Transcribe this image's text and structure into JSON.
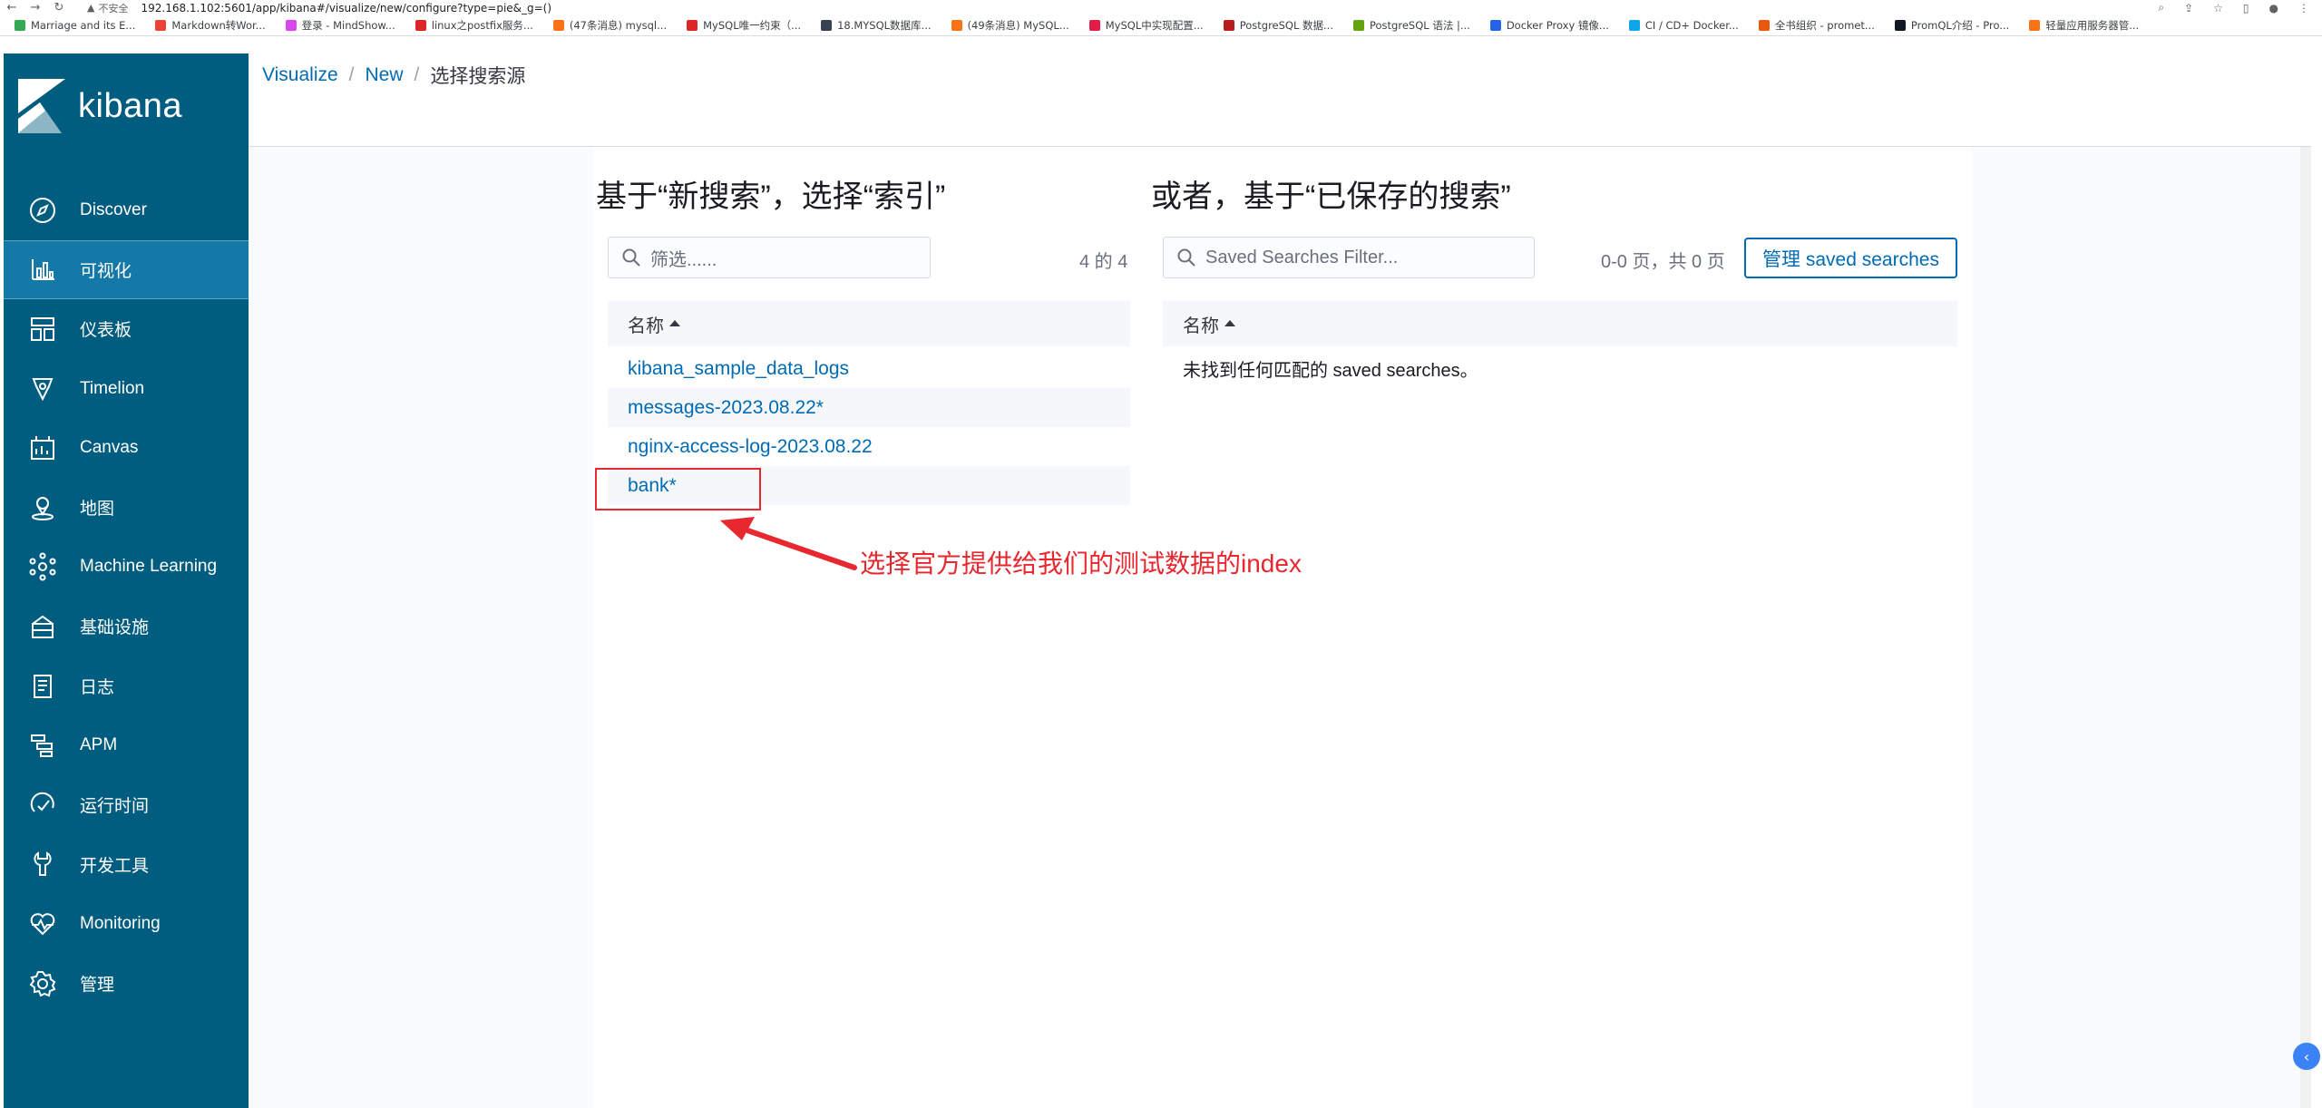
{
  "browser": {
    "warning": "▲",
    "insecure_label": "不安全",
    "url": "192.168.1.102:5601/app/kibana#/visualize/new/configure?type=pie&_g=()",
    "bookmarks": [
      {
        "label": "Marriage and its E...",
        "color": "#34a853"
      },
      {
        "label": "Markdown转Wor...",
        "color": "#ea4335"
      },
      {
        "label": "登录 - MindShow...",
        "color": "#d946ef"
      },
      {
        "label": "linux之postfix服务...",
        "color": "#dc2626"
      },
      {
        "label": "(47条消息) mysql...",
        "color": "#f97316"
      },
      {
        "label": "MySQL唯一约束（...",
        "color": "#dc2626"
      },
      {
        "label": "18.MYSQL数据库...",
        "color": "#374151"
      },
      {
        "label": "(49条消息) MySQL...",
        "color": "#f97316"
      },
      {
        "label": "MySQL中实现配置...",
        "color": "#e11d48"
      },
      {
        "label": "PostgreSQL 数据...",
        "color": "#b91c1c"
      },
      {
        "label": "PostgreSQL 语法 |...",
        "color": "#65a30d"
      },
      {
        "label": "Docker Proxy 镜像...",
        "color": "#2563eb"
      },
      {
        "label": "CI / CD+ Docker...",
        "color": "#0ea5e9"
      },
      {
        "label": "全书组织 - promet...",
        "color": "#ea580c"
      },
      {
        "label": "PromQL介绍 - Pro...",
        "color": "#111827"
      },
      {
        "label": "轻量应用服务器管...",
        "color": "#f97316"
      }
    ]
  },
  "app": {
    "logo_text": "kibana",
    "nav": [
      {
        "label": "Discover",
        "icon": "compass-icon",
        "active": false
      },
      {
        "label": "可视化",
        "icon": "visualize-icon",
        "active": true
      },
      {
        "label": "仪表板",
        "icon": "dashboard-icon",
        "active": false
      },
      {
        "label": "Timelion",
        "icon": "timelion-icon",
        "active": false
      },
      {
        "label": "Canvas",
        "icon": "canvas-icon",
        "active": false
      },
      {
        "label": "地图",
        "icon": "map-icon",
        "active": false
      },
      {
        "label": "Machine Learning",
        "icon": "ml-icon",
        "active": false
      },
      {
        "label": "基础设施",
        "icon": "infrastructure-icon",
        "active": false
      },
      {
        "label": "日志",
        "icon": "logs-icon",
        "active": false
      },
      {
        "label": "APM",
        "icon": "apm-icon",
        "active": false
      },
      {
        "label": "运行时间",
        "icon": "uptime-icon",
        "active": false
      },
      {
        "label": "开发工具",
        "icon": "devtools-icon",
        "active": false
      },
      {
        "label": "Monitoring",
        "icon": "monitoring-icon",
        "active": false
      },
      {
        "label": "管理",
        "icon": "gear-icon",
        "active": false
      }
    ]
  },
  "breadcrumb": {
    "items": [
      "Visualize",
      "New"
    ],
    "separator": "/",
    "current": "选择搜索源"
  },
  "left_panel": {
    "title": "基于“新搜索”，选择“索引”",
    "search_placeholder": "筛选......",
    "count": "4 的 4",
    "column": "名称",
    "rows": [
      "kibana_sample_data_logs",
      "messages-2023.08.22*",
      "nginx-access-log-2023.08.22",
      "bank*"
    ]
  },
  "right_panel": {
    "title": "或者，基于“已保存的搜索”",
    "search_placeholder": "Saved Searches Filter...",
    "pagination": "0-0 页，共 0 页",
    "manage_button": "管理 saved searches",
    "column": "名称",
    "empty_message": "未找到任何匹配的 saved searches。"
  },
  "annotation": {
    "text": "选择官方提供给我们的测试数据的index",
    "color": "#e8272f"
  },
  "colors": {
    "sidebar": "#015d80",
    "sidebar_active": "#1479a6",
    "link": "#006bb4"
  }
}
